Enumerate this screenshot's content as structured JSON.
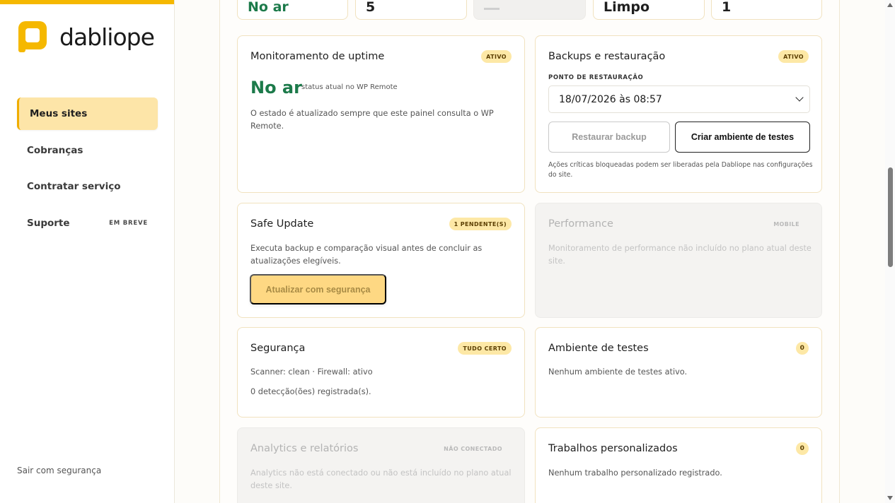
{
  "brand": {
    "name": "dabliope",
    "accent": "#f5b800"
  },
  "sidebar": {
    "items": [
      {
        "label": "Meus sites",
        "badge": ""
      },
      {
        "label": "Cobranças",
        "badge": ""
      },
      {
        "label": "Contratar serviço",
        "badge": ""
      },
      {
        "label": "Suporte",
        "badge": "EM BREVE"
      }
    ],
    "logout": "Sair com segurança"
  },
  "summary": {
    "items": [
      "No ar",
      "5",
      "",
      "Limpo",
      "1"
    ]
  },
  "uptime": {
    "title": "Monitoramento de uptime",
    "badge": "ATIVO",
    "status": "No ar",
    "status_note": "status atual no WP Remote",
    "description": "O estado é atualizado sempre que este painel consulta o WP Remote."
  },
  "backups": {
    "title": "Backups e restauração",
    "badge": "ATIVO",
    "field_label": "PONTO DE RESTAURAÇÃO",
    "selected": "18/07/2026 às 08:57",
    "restore_label": "Restaurar backup",
    "staging_label": "Criar ambiente de testes",
    "note": "Ações críticas bloqueadas podem ser liberadas pela Dabliope nas configurações do site."
  },
  "safe_update": {
    "title": "Safe Update",
    "badge": "1 PENDENTE(S)",
    "description": "Executa backup e comparação visual antes de concluir as atualizações elegíveis.",
    "button": "Atualizar com segurança"
  },
  "performance": {
    "title": "Performance",
    "badge": "MOBILE",
    "description": "Monitoramento de performance não incluído no plano atual deste site."
  },
  "security": {
    "title": "Segurança",
    "badge": "TUDO CERTO",
    "line1": "Scanner: clean · Firewall: ativo",
    "line2": "0 detecção(ões) registrada(s)."
  },
  "staging": {
    "title": "Ambiente de testes",
    "badge": "0",
    "description": "Nenhum ambiente de testes ativo."
  },
  "analytics": {
    "title": "Analytics e relatórios",
    "badge": "NÃO CONECTADO",
    "description": "Analytics não está conectado ou não está incluído no plano atual deste site."
  },
  "custom_jobs": {
    "title": "Trabalhos personalizados",
    "badge": "0",
    "description": "Nenhum trabalho personalizado registrado."
  }
}
